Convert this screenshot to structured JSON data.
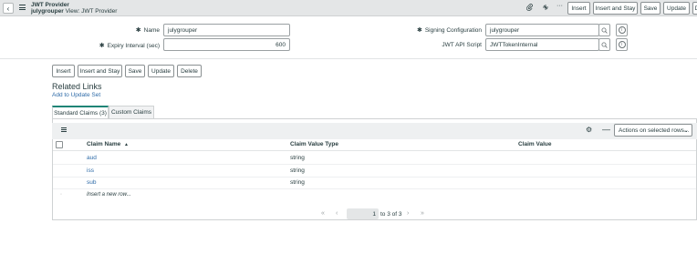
{
  "header": {
    "title": "JWT Provider",
    "record_name": "julygrouper",
    "view_label": "View: JWT Provider",
    "buttons": {
      "insert": "Insert",
      "insert_stay": "Insert and Stay",
      "save": "Save",
      "update": "Update",
      "partial": "D"
    }
  },
  "form": {
    "name_label": "Name",
    "name_value": "julygrouper",
    "expiry_label": "Expiry Interval (sec)",
    "expiry_value": "600",
    "signing_label": "Signing Configuration",
    "signing_value": "julygrouper",
    "script_label": "JWT API Script",
    "script_value": "JWTTokenInternal",
    "required_marker": "✱"
  },
  "actions": {
    "insert": "Insert",
    "insert_stay": "Insert and Stay",
    "save": "Save",
    "update": "Update",
    "delete": "Delete"
  },
  "related": {
    "title": "Related Links",
    "add_to_update_set": "Add to Update Set"
  },
  "tabs": [
    {
      "label": "Standard Claims (3)",
      "active": true
    },
    {
      "label": "Custom Claims",
      "active": false
    }
  ],
  "list": {
    "actions_select": "Actions on selected rows...",
    "columns": [
      "Claim Name",
      "Claim Value Type",
      "Claim Value"
    ],
    "sort_indicator": "▲",
    "rows": [
      {
        "name": "aud",
        "type": "string",
        "value": ""
      },
      {
        "name": "iss",
        "type": "string",
        "value": ""
      },
      {
        "name": "sub",
        "type": "string",
        "value": ""
      }
    ],
    "insert_row": "Insert a new row..."
  },
  "pagination": {
    "current": "1",
    "range_text": "to 3 of 3"
  },
  "colors": {
    "accent": "#1f8476",
    "link": "#2e6ba8",
    "header_bg": "#e4e6e7"
  },
  "icons": [
    "back-icon",
    "menu-icon",
    "paperclip-icon",
    "settings-icon",
    "more-icon",
    "search-icon",
    "info-icon",
    "gear-icon",
    "minus-icon",
    "sort-up-icon",
    "first-page-icon",
    "prev-page-icon",
    "next-page-icon",
    "last-page-icon"
  ]
}
